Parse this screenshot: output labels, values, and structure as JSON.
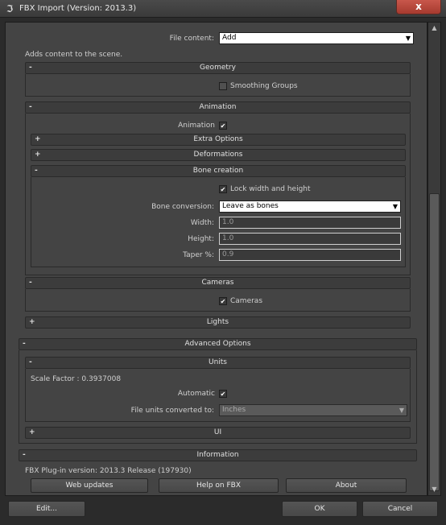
{
  "window": {
    "title": "FBX Import (Version: 2013.3)",
    "close_glyph": "x",
    "app_icon": "3ds-max-icon"
  },
  "file_content": {
    "label": "File content:",
    "value": "Add",
    "description": "Adds content to the scene."
  },
  "geometry": {
    "header": "Geometry",
    "smoothing_groups": "Smoothing Groups"
  },
  "animation": {
    "header": "Animation",
    "animation_label": "Animation",
    "extra_options": "Extra Options",
    "deformations": "Deformations",
    "bone_creation": {
      "header": "Bone creation",
      "lock_label": "Lock width and height",
      "conversion_label": "Bone conversion:",
      "conversion_value": "Leave as bones",
      "width_label": "Width:",
      "width_value": "1.0",
      "height_label": "Height:",
      "height_value": "1.0",
      "taper_label": "Taper %:",
      "taper_value": "0.9"
    }
  },
  "cameras": {
    "header": "Cameras",
    "cameras_label": "Cameras"
  },
  "lights": {
    "header": "Lights"
  },
  "advanced": {
    "header": "Advanced Options",
    "units": {
      "header": "Units",
      "scale_factor": "Scale Factor : 0.3937008",
      "automatic_label": "Automatic",
      "converted_label": "File units converted to:",
      "converted_value": "Inches"
    },
    "ui": {
      "header": "UI"
    }
  },
  "information": {
    "header": "Information",
    "version_text": "FBX Plug-in version: 2013.3 Release (197930)",
    "web_updates": "Web updates",
    "help": "Help on FBX",
    "about": "About"
  },
  "footer": {
    "edit": "Edit...",
    "ok": "OK",
    "cancel": "Cancel"
  },
  "signs": {
    "minus": "-",
    "plus": "+"
  }
}
